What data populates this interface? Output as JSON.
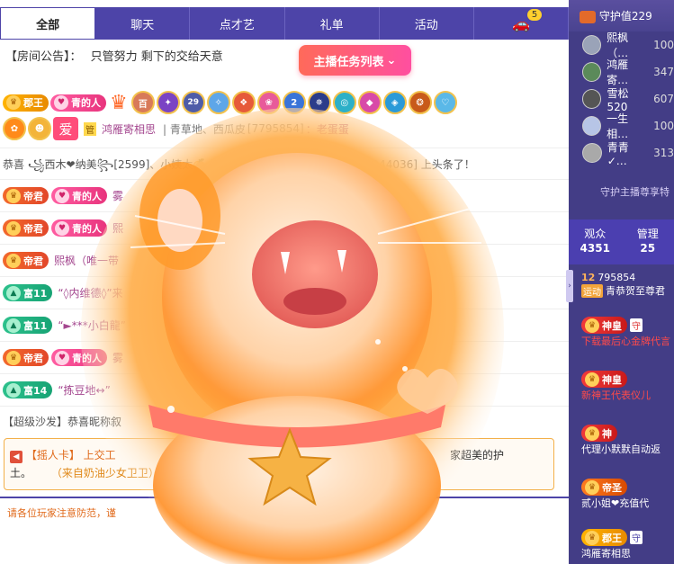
{
  "tabs": [
    "全部",
    "聊天",
    "点才艺",
    "礼单",
    "活动"
  ],
  "car_badge": "5",
  "announce": {
    "label": "【房间公告】：",
    "text": "只管努力 剩下的交给天意"
  },
  "task_button": "主播任务列表",
  "badges": {
    "king": "郡王",
    "emperor": "帝君",
    "love": "青的人",
    "rich11": "富11",
    "rich14": "富14",
    "num100": "百",
    "num29": "29",
    "num2": "2",
    "guan": "管",
    "love_char": "爱",
    "god": "神",
    "god_full": "神皇",
    "saint": "帝圣",
    "shou": "守"
  },
  "user_line": {
    "name": "鸿雁寄相思",
    "location": "青草地、西瓜皮",
    "id": "[7795854]",
    "suffix": "：老蛋蛋"
  },
  "congrats": "恭喜 ꧁西木❤纳美꧂[2599]、小姨太🍊金财好色[89800]、晴儿感谢有你[944036] 上头条了！",
  "chat": [
    {
      "name": "雾"
    },
    {
      "name": "熙"
    },
    {
      "name": "熙枫（唯一带"
    },
    {
      "name": "“◊内维德◊”来"
    },
    {
      "name": "“►***小白龍”"
    },
    {
      "name": "雾"
    },
    {
      "name": "“拣豆地↔”"
    }
  ],
  "sofa": {
    "label": "【超级沙发】",
    "text": "恭喜昵称叙"
  },
  "notice": {
    "prefix": "【摇人卡】",
    "text": "上交工",
    "tail": "家超美的护",
    "line2": "土。",
    "from": "（来自奶油少女卫卫）"
  },
  "bottom_tip": "请各位玩家注意防范，谨",
  "right": {
    "guard_top": "守护值229",
    "guards": [
      {
        "name": "熙枫（…",
        "val": "100"
      },
      {
        "name": "鸿雁寄…",
        "val": "347"
      },
      {
        "name": "雪松520",
        "val": "607"
      },
      {
        "name": "一生相…",
        "val": "100"
      },
      {
        "name": "青青✓…",
        "val": "313"
      }
    ],
    "guard_honor": "守护主播尊享特",
    "stats": {
      "viewers_label": "观众",
      "viewers": "4351",
      "admin_label": "管理",
      "admin": "25"
    },
    "rank": {
      "top_id": "795854",
      "top_prefix": "12",
      "top_tag": "运动",
      "top_text": "青恭贺至尊君",
      "r1_text": "下载最后心金牌代言",
      "r2_text": "新神王代表仪儿",
      "r3_text": "代理小默默自动返",
      "r4_text": "贰小姐❤充值代",
      "r5_name": "鸿雁寄相思"
    }
  }
}
